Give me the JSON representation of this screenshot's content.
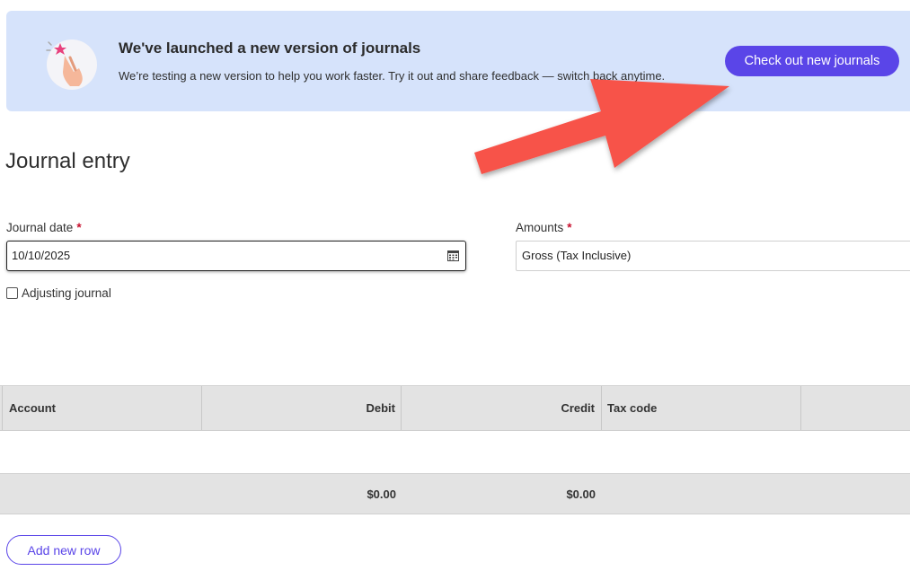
{
  "banner": {
    "title": "We've launched a new version of journals",
    "subtitle": "We’re testing a new version to help you work faster. Try it out and share feedback — switch back anytime.",
    "cta_label": "Check out new journals",
    "accent_color": "#5a45e8",
    "background_color": "#d6e3fb"
  },
  "page": {
    "title": "Journal entry"
  },
  "form": {
    "journal_date_label": "Journal date",
    "journal_date_value": "10/10/2025",
    "amounts_label": "Amounts",
    "amounts_value": "Gross (Tax Inclusive)",
    "required_marker": "*",
    "adjusting_label": "Adjusting journal",
    "adjusting_checked": false
  },
  "grid": {
    "columns": [
      "Account",
      "Debit",
      "Credit",
      "Tax code",
      ""
    ],
    "totals": {
      "debit": "$0.00",
      "credit": "$0.00"
    }
  },
  "actions": {
    "add_row_label": "Add new row"
  },
  "annotation": {
    "arrow_color": "#f7524a",
    "icon": "arrow-annotation-icon"
  }
}
